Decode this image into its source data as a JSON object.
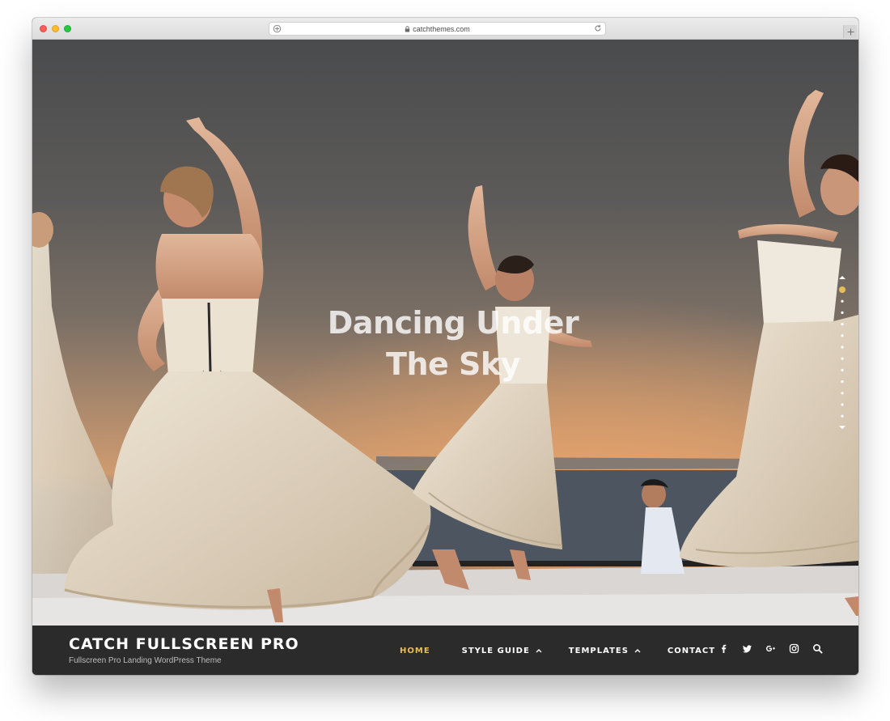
{
  "browser": {
    "url": "catchthemes.com",
    "icons": [
      "privacy-icon",
      "lock-icon",
      "reload-icon",
      "new-tab-plus-icon"
    ]
  },
  "hero": {
    "title_line1": "Dancing Under",
    "title_line2": "The Sky",
    "slide_dots": {
      "count": 12,
      "active_index": 0
    }
  },
  "site": {
    "title": "CATCH FULLSCREEN PRO",
    "tagline": "Fullscreen Pro Landing WordPress Theme"
  },
  "nav": {
    "items": [
      {
        "label": "HOME",
        "active": true,
        "has_submenu": false
      },
      {
        "label": "STYLE GUIDE",
        "active": false,
        "has_submenu": true
      },
      {
        "label": "TEMPLATES",
        "active": false,
        "has_submenu": true
      },
      {
        "label": "CONTACT",
        "active": false,
        "has_submenu": false
      }
    ]
  },
  "social": [
    "facebook-icon",
    "twitter-icon",
    "google-plus-icon",
    "instagram-icon",
    "search-icon"
  ],
  "colors": {
    "accent": "#e8bc5c",
    "header_bg": "#2b2b2b",
    "text": "#ffffff"
  }
}
